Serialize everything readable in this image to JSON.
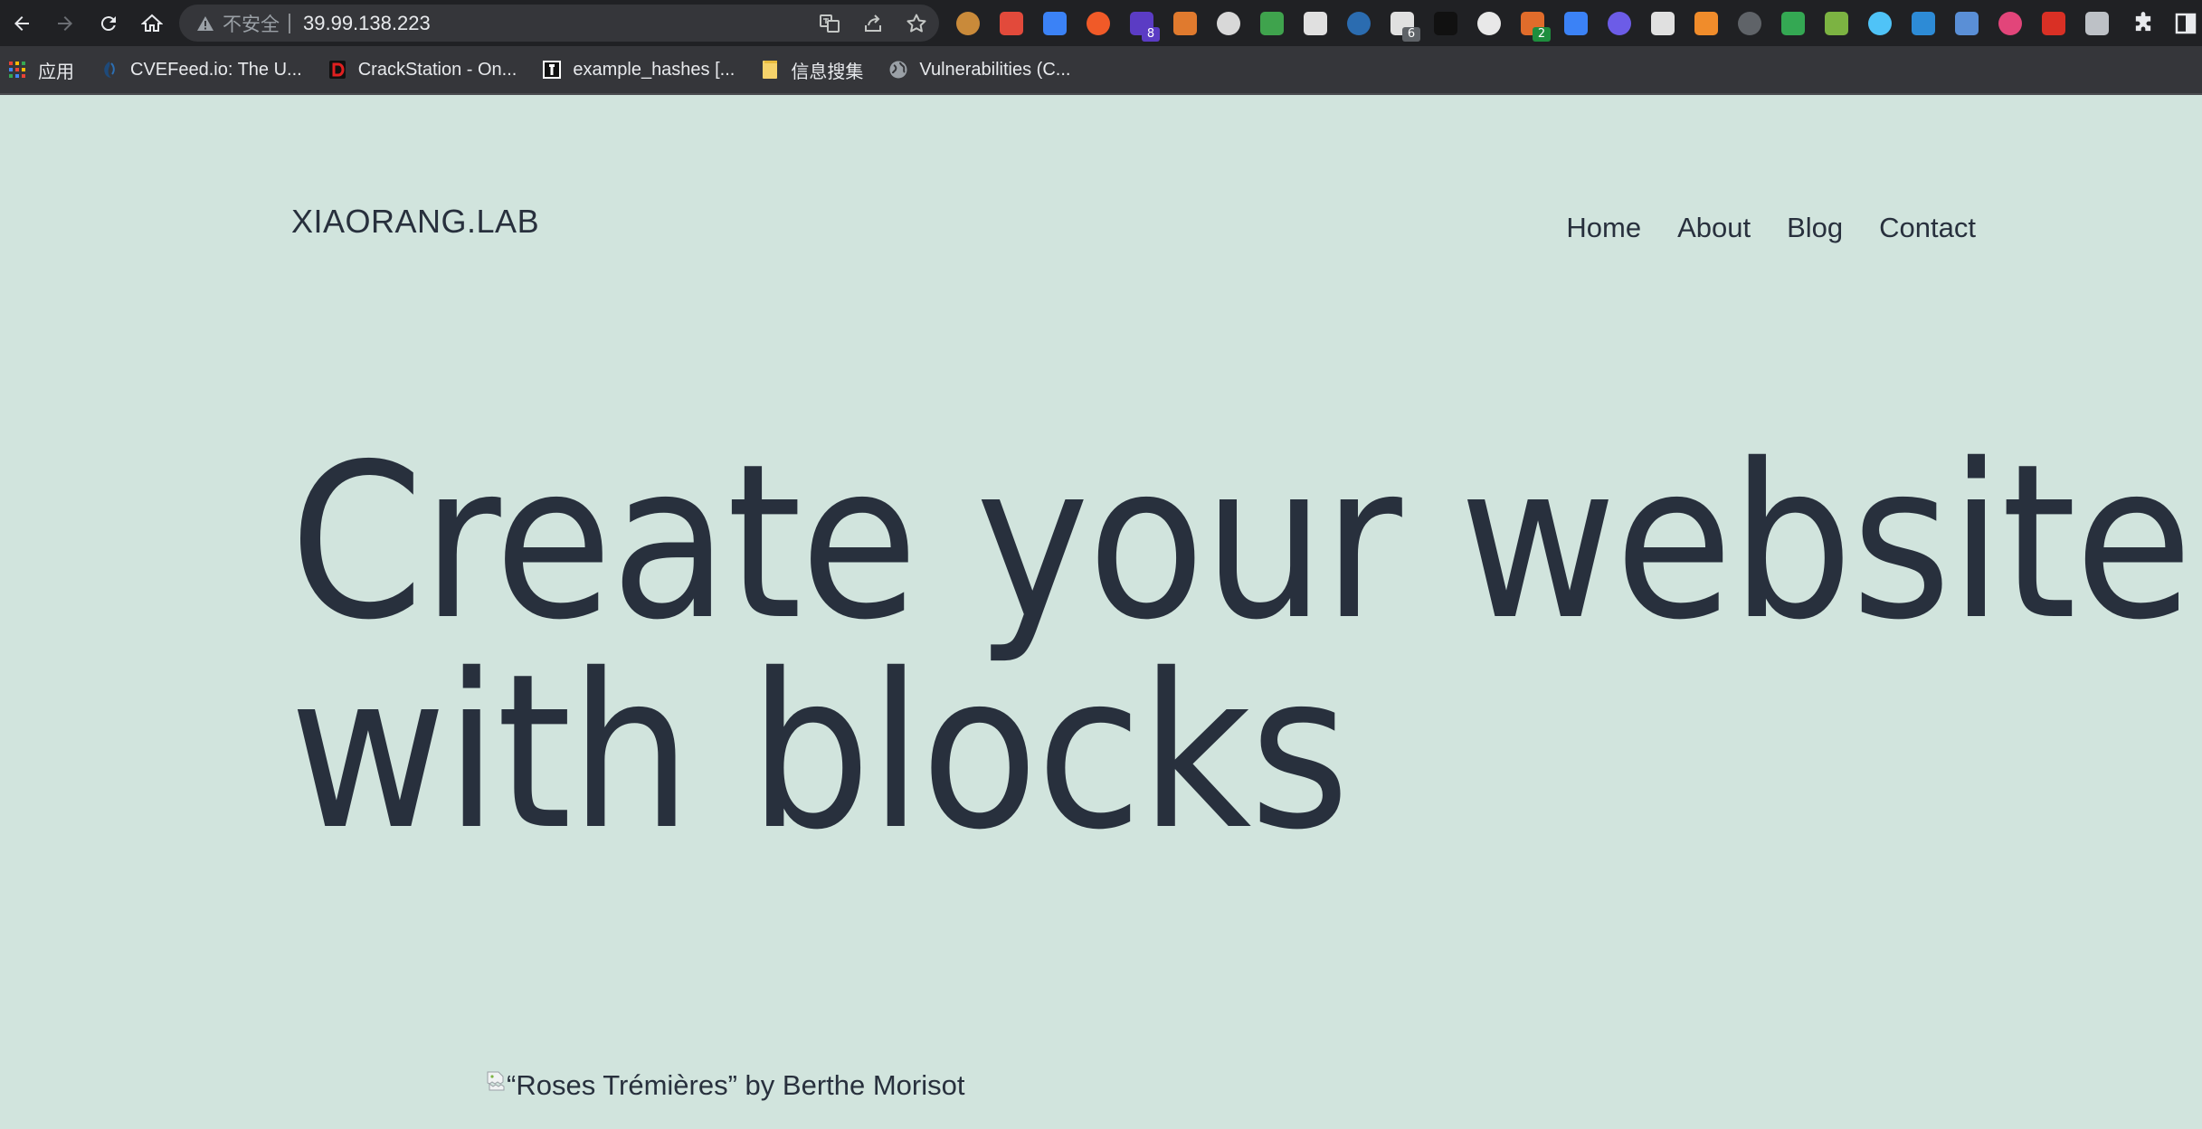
{
  "browser": {
    "security_label": "不安全",
    "url": "39.99.138.223",
    "extensions": [
      {
        "icon": "cookie-extension-icon",
        "color": "#c98a3a"
      },
      {
        "icon": "dice-extension-icon",
        "color": "#e24a3b"
      },
      {
        "icon": "mask-extension-icon",
        "color": "#3b82f6"
      },
      {
        "icon": "translate-extension-icon",
        "color": "#f05a28"
      },
      {
        "icon": "cube-extension-icon",
        "color": "#5b3cc4",
        "badge": "8",
        "badge_color": "#5b3cc4"
      },
      {
        "icon": "firefox-like-extension-icon",
        "color": "#e07a2e"
      },
      {
        "icon": "cluster-extension-icon",
        "color": "#d8d8d8"
      },
      {
        "icon": "globe-extension-icon",
        "color": "#3fa34d"
      },
      {
        "icon": "ip-extension-icon",
        "color": "#e0e0e0"
      },
      {
        "icon": "wave-extension-icon",
        "color": "#2b6cb0"
      },
      {
        "icon": "qr-extension-icon",
        "color": "#e0e0e0",
        "badge": "6",
        "badge_color": "#5f6368"
      },
      {
        "icon": "hat-extension-icon",
        "color": "#111111"
      },
      {
        "icon": "helmet-extension-icon",
        "color": "#e8e8e8"
      },
      {
        "icon": "fork-extension-icon",
        "color": "#e06c2b",
        "badge": "2",
        "badge_color": "#1e8e3e"
      },
      {
        "icon": "bars-extension-icon",
        "color": "#3b82f6"
      },
      {
        "icon": "moon-extension-icon",
        "color": "#6c5ce7"
      },
      {
        "icon": "glasses-extension-icon",
        "color": "#e0e0e0"
      },
      {
        "icon": "arrow-extension-icon",
        "color": "#f08c2b"
      },
      {
        "icon": "copy-extension-icon",
        "color": "#5f6368"
      },
      {
        "icon": "gear-extension-icon",
        "color": "#34a853"
      },
      {
        "icon": "grid-extension-icon",
        "color": "#7cb342"
      },
      {
        "icon": "diamond-extension-icon",
        "color": "#4fc3f7"
      },
      {
        "icon": "screen-extension-icon",
        "color": "#2d8bd6"
      },
      {
        "icon": "star-box-extension-icon",
        "color": "#5a8fd6"
      },
      {
        "icon": "text-extension-icon",
        "color": "#e2457a"
      },
      {
        "icon": "s-circle-extension-icon",
        "color": "#d93025"
      },
      {
        "icon": "ring-extension-icon",
        "color": "#bdc1c6"
      }
    ],
    "bookmarks": [
      {
        "label": "应用",
        "icon": "apps-grid-icon"
      },
      {
        "label": "CVEFeed.io: The U...",
        "icon": "cvefeed-favicon-icon"
      },
      {
        "label": "CrackStation - On...",
        "icon": "crackstation-favicon-icon"
      },
      {
        "label": "example_hashes [...",
        "icon": "hashcat-favicon-icon"
      },
      {
        "label": "信息搜集",
        "icon": "folder-icon"
      },
      {
        "label": "Vulnerabilities (C...",
        "icon": "globe-favicon-icon"
      }
    ]
  },
  "site": {
    "title": "XIAORANG.LAB",
    "nav": [
      "Home",
      "About",
      "Blog",
      "Contact"
    ],
    "hero_line1": "Create your website",
    "hero_line2": "with blocks",
    "image_alt": "“Roses Trémières” by Berthe Morisot"
  },
  "colors": {
    "page_background": "#d1e4dd",
    "text": "#28303d",
    "toolbar": "#202124",
    "bookmarks_bar": "#35363a"
  }
}
